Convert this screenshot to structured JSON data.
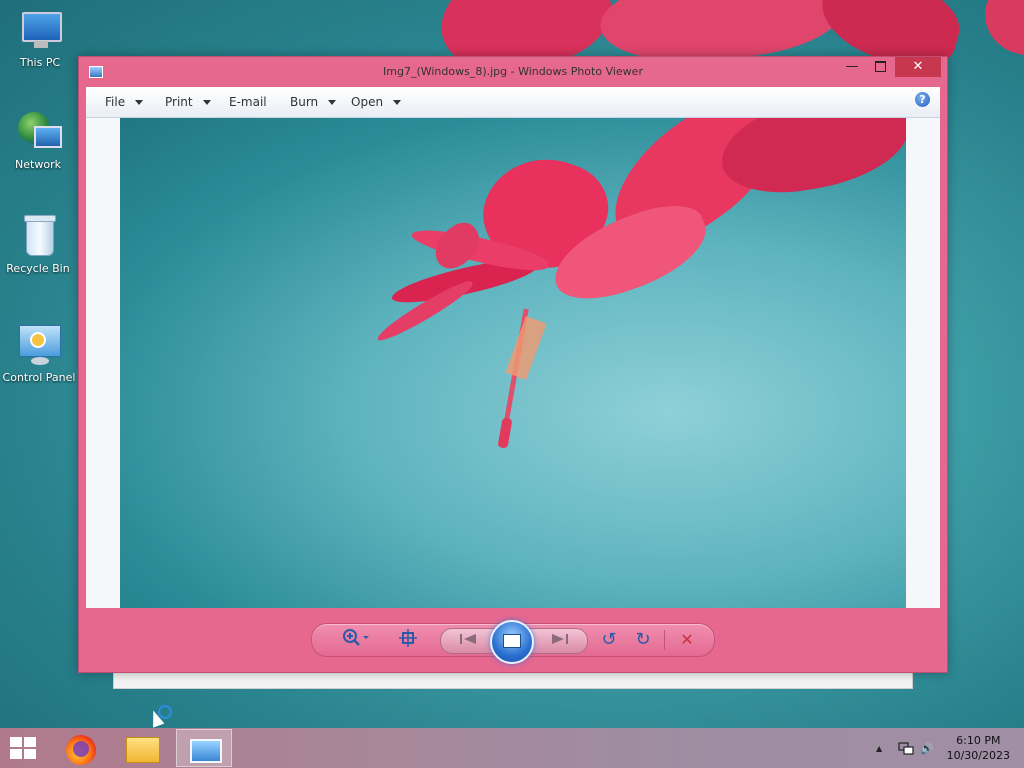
{
  "desktop": {
    "icons": [
      {
        "label": "This PC",
        "icon": "computer-icon"
      },
      {
        "label": "Network",
        "icon": "network-icon"
      },
      {
        "label": "Recycle Bin",
        "icon": "recycle-bin-icon"
      },
      {
        "label": "Control Panel",
        "icon": "control-panel-icon"
      }
    ]
  },
  "window": {
    "title": "Img7_(Windows_8).jpg - Windows Photo Viewer",
    "min_glyph": "—",
    "close_glyph": "✕",
    "accent": "#e6688f",
    "menu": [
      {
        "label": "File",
        "has_caret": true
      },
      {
        "label": "Print",
        "has_caret": true
      },
      {
        "label": "E-mail",
        "has_caret": false
      },
      {
        "label": "Burn",
        "has_caret": true
      },
      {
        "label": "Open",
        "has_caret": true
      }
    ],
    "help_glyph": "?",
    "controls": {
      "zoom_icon": "zoom-icon",
      "actual_size_icon": "fit-window-icon",
      "previous_icon": "previous-icon",
      "slideshow_icon": "slideshow-icon",
      "next_icon": "next-icon",
      "rotate_ccw_glyph": "↺",
      "rotate_cw_glyph": "↻",
      "delete_glyph": "✕"
    }
  },
  "taskbar": {
    "time": "6:10 PM",
    "date": "10/30/2023",
    "apps": [
      {
        "name": "firefox-icon"
      },
      {
        "name": "file-explorer-icon"
      },
      {
        "name": "photo-viewer-icon",
        "active": true
      }
    ],
    "tray_up": "▲",
    "tray_speaker": "🔊"
  }
}
